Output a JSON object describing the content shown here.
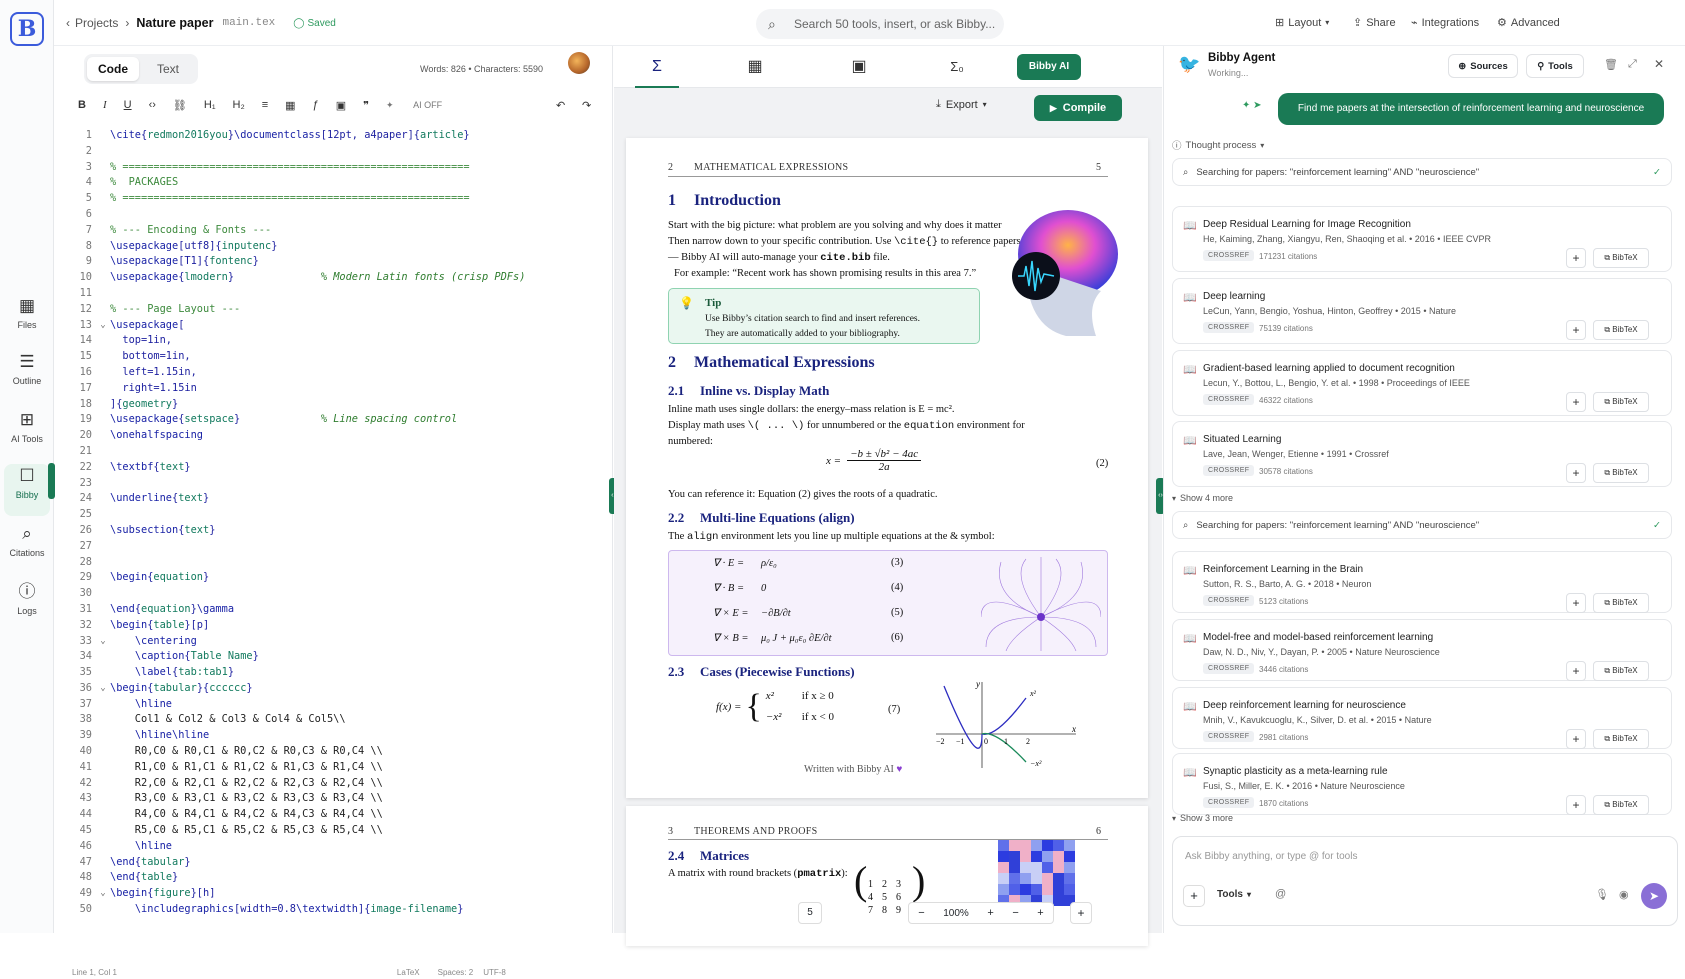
{
  "app": {
    "logo": "B"
  },
  "rail": [
    {
      "icon": "files-icon",
      "glyph": "▦",
      "label": "Files"
    },
    {
      "icon": "outline-icon",
      "glyph": "☰",
      "label": "Outline"
    },
    {
      "icon": "ai-tools-icon",
      "glyph": "⊞",
      "label": "AI Tools"
    },
    {
      "icon": "bibby-icon",
      "glyph": "☐",
      "label": "Bibby"
    },
    {
      "icon": "citations-icon",
      "glyph": "⌕",
      "label": "Citations"
    },
    {
      "icon": "logs-icon",
      "glyph": "ⓘ",
      "label": "Logs"
    }
  ],
  "topbar": {
    "back": "Projects",
    "project": "Nature paper",
    "file": "main.tex",
    "saved": "Saved",
    "search_placeholder": "Search 50 tools, insert, or ask Bibby...",
    "layout": "Layout",
    "share": "Share",
    "integrations": "Integrations",
    "advanced": "Advanced"
  },
  "editor": {
    "tab_code": "Code",
    "tab_text": "Text",
    "words": "Words: 826 • Characters: 5590",
    "ai": "AI OFF",
    "status_pos": "Line 1, Col 1",
    "status_lang": "LaTeX",
    "status_spaces": "Spaces: 2",
    "status_enc": "UTF-8"
  },
  "code_lines": [
    "\\cite{redmon2016you}\\documentclass[12pt, a4paper]{article}",
    "",
    "% ========================================================",
    "%  PACKAGES",
    "% ========================================================",
    "",
    "% --- Encoding & Fonts ---",
    "\\usepackage[utf8]{inputenc}",
    "\\usepackage[T1]{fontenc}",
    "\\usepackage{lmodern}              % Modern Latin fonts (crisp PDFs)",
    "",
    "% --- Page Layout ---",
    "\\usepackage[",
    "  top=1in,",
    "  bottom=1in,",
    "  left=1.15in,",
    "  right=1.15in",
    "]{geometry}",
    "\\usepackage{setspace}             % Line spacing control",
    "\\onehalfspacing",
    "",
    "\\textbf{text}",
    "",
    "\\underline{text}",
    "",
    "\\subsection{text}",
    "",
    "",
    "\\begin{equation}",
    "",
    "\\end{equation}\\gamma",
    "\\begin{table}[p]",
    "    \\centering",
    "    \\caption{Table Name}",
    "    \\label{tab:tab1}",
    "\\begin{tabular}{cccccc}",
    "    \\hline",
    "    Col1 & Col2 & Col3 & Col4 & Col5\\\\",
    "    \\hline\\hline",
    "    R0,C0 & R0,C1 & R0,C2 & R0,C3 & R0,C4 \\\\",
    "    R1,C0 & R1,C1 & R1,C2 & R1,C3 & R1,C4 \\\\",
    "    R2,C0 & R2,C1 & R2,C2 & R2,C3 & R2,C4 \\\\",
    "    R3,C0 & R3,C1 & R3,C2 & R3,C3 & R3,C4 \\\\",
    "    R4,C0 & R4,C1 & R4,C2 & R4,C3 & R4,C4 \\\\",
    "    R5,C0 & R5,C1 & R5,C2 & R5,C3 & R5,C4 \\\\",
    "    \\hline",
    "\\end{tabular}",
    "\\end{table}",
    "\\begin{figure}[h]",
    "    \\includegraphics[width=0.8\\textwidth]{image-filename}"
  ],
  "fold_lines": [
    13,
    33,
    36,
    49
  ],
  "preview": {
    "bibby_ai": "Bibby AI",
    "export": "Export",
    "compile": "Compile",
    "p1_header_num": "2",
    "p1_header": "MATHEMATICAL EXPRESSIONS",
    "p1_page": "5",
    "s1_num": "1",
    "s1_title": "Introduction",
    "intro_1": "Start with the big picture: what problem are you solving and why does it matter",
    "intro_2a": "Then narrow down to your specific contribution. Use ",
    "intro_2b": "\\cite{}",
    "intro_2c": " to reference papers",
    "intro_3a": "— Bibby AI will auto-manage your ",
    "intro_3b": "cite.bib",
    "intro_3c": " file.",
    "intro_4": "For example: “Recent work has shown promising results in this area 7.”",
    "tip_title": "Tip",
    "tip_1": "Use Bibby’s citation search to find and insert references.",
    "tip_2": "They are automatically added to your bibliography.",
    "s2_num": "2",
    "s2_title": "Mathematical Expressions",
    "s21_num": "2.1",
    "s21_title": "Inline vs. Display Math",
    "s21_t1": "Inline math uses single dollars: the energy–mass relation is E = mc².",
    "s21_t2a": "Display math uses ",
    "s21_t2b": "\\( ... \\)",
    "s21_t2c": " for unnumbered or the ",
    "s21_t2d": "equation",
    "s21_t2e": " environment for",
    "s21_t3": "numbered:",
    "eq2_lhs": "x =",
    "eq2_num": "−b ± √b² − 4ac",
    "eq2_den": "2a",
    "eq2_tag": "(2)",
    "s21_t4": "You can reference it: Equation (2) gives the roots of a quadratic.",
    "s22_num": "2.2",
    "s22_title": "Multi-line Equations (align)",
    "s22_t1a": "The ",
    "s22_t1b": "align",
    "s22_t1c": " environment lets you line up multiple equations at the & symbol:",
    "align": [
      {
        "lhs": "∇ · E =",
        "rhs": "ρ/ε₀",
        "tag": "(3)"
      },
      {
        "lhs": "∇ · B =",
        "rhs": "0",
        "tag": "(4)"
      },
      {
        "lhs": "∇ × E =",
        "rhs": "−∂B/∂t",
        "tag": "(5)"
      },
      {
        "lhs": "∇ × B =",
        "rhs": "μ₀ J + μ₀ε₀ ∂E/∂t",
        "tag": "(6)"
      }
    ],
    "s23_num": "2.3",
    "s23_title": "Cases (Piecewise Functions)",
    "cases_lhs": "f(x) =",
    "case1": "x²",
    "case1_c": "if x ≥ 0",
    "case2": "−x²",
    "case2_c": "if x < 0",
    "cases_tag": "(7)",
    "plot_x": "x",
    "plot_y": "y",
    "plot_f1": "x²",
    "plot_f2": "−x²",
    "footer_credit": "Written with Bibby AI",
    "p2_header_num": "3",
    "p2_header": "THEOREMS AND PROOFS",
    "p2_page": "6",
    "s24_num": "2.4",
    "s24_title": "Matrices",
    "s24_t1a": "A matrix with round brackets (",
    "s24_t1b": "pmatrix",
    "s24_t1c": "):",
    "matrix": [
      [
        "1",
        "2",
        "3"
      ],
      [
        "4",
        "5",
        "6"
      ],
      [
        "7",
        "8",
        "9"
      ]
    ],
    "page_num": "5",
    "zoom": "100%"
  },
  "agent": {
    "name": "Bibby Agent",
    "status": "Working...",
    "sources": "Sources",
    "tools": "Tools",
    "user_msg": "Find me papers at the intersection of reinforcement learning and neuroscience",
    "thought": "Thought process",
    "search1": "Searching for papers: \"reinforcement learning\" AND \"neuroscience\"",
    "search2": "Searching for papers: \"reinforcement learning\" AND \"neuroscience\"",
    "show_more1": "Show 4 more",
    "show_more2": "Show 3 more",
    "group1": [
      {
        "title": "Deep Residual Learning for Image Recognition",
        "meta": "He, Kaiming, Zhang, Xiangyu, Ren, Shaoqing et al. • 2016 • IEEE CVPR",
        "source": "CROSSREF",
        "citations": "171231 citations"
      },
      {
        "title": "Deep learning",
        "meta": "LeCun, Yann, Bengio, Yoshua, Hinton, Geoffrey • 2015 • Nature",
        "source": "CROSSREF",
        "citations": "75139 citations"
      },
      {
        "title": "Gradient-based learning applied to document recognition",
        "meta": "Lecun, Y., Bottou, L., Bengio, Y. et al. • 1998 • Proceedings of IEEE",
        "source": "CROSSREF",
        "citations": "46322 citations"
      },
      {
        "title": "Situated Learning",
        "meta": "Lave, Jean, Wenger, Etienne • 1991 • Crossref",
        "source": "CROSSREF",
        "citations": "30578 citations"
      }
    ],
    "group2": [
      {
        "title": "Reinforcement Learning in the Brain",
        "meta": "Sutton, R. S., Barto, A. G. • 2018 • Neuron",
        "source": "CROSSREF",
        "citations": "5123 citations"
      },
      {
        "title": "Model-free and model-based reinforcement learning",
        "meta": "Daw, N. D., Niv, Y., Dayan, P. • 2005 • Nature Neuroscience",
        "source": "CROSSREF",
        "citations": "3446 citations"
      },
      {
        "title": "Deep reinforcement learning for neuroscience",
        "meta": "Mnih, V., Kavukcuoglu, K., Silver, D. et al. • 2015 • Nature",
        "source": "CROSSREF",
        "citations": "2981 citations"
      },
      {
        "title": "Synaptic plasticity as a meta-learning rule",
        "meta": "Fusi, S., Miller, E. K. • 2016 • Nature Neuroscience",
        "source": "CROSSREF",
        "citations": "1870 citations"
      }
    ],
    "bibtex": "BibTeX",
    "input_placeholder": "Ask Bibby anything, or type @ for tools",
    "tools_btn": "Tools"
  },
  "colors": {
    "accent": "#1a7a55",
    "brand": "#3b5bdb",
    "section": "#1a237e"
  }
}
